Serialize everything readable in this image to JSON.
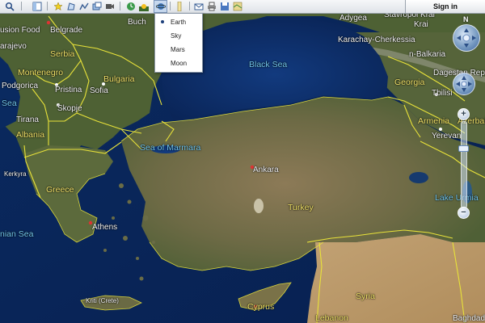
{
  "toolbar": {
    "tools": [
      {
        "icon": "search-icon"
      },
      {
        "icon": "sidebar-toggle-icon"
      },
      {
        "icon": "placemark-pin-icon"
      },
      {
        "icon": "polygon-icon"
      },
      {
        "icon": "path-icon"
      },
      {
        "icon": "overlay-icon"
      },
      {
        "icon": "record-tour-icon"
      },
      {
        "icon": "historical-imagery-icon"
      },
      {
        "icon": "sunlight-icon"
      },
      {
        "icon": "planets-icon"
      },
      {
        "icon": "ruler-icon"
      },
      {
        "icon": "email-icon"
      },
      {
        "icon": "print-icon"
      },
      {
        "icon": "save-image-icon"
      },
      {
        "icon": "view-in-maps-icon"
      }
    ],
    "sign_in_label": "Sign in"
  },
  "planet_menu": {
    "options": [
      "Earth",
      "Sky",
      "Mars",
      "Moon"
    ],
    "selected": "Earth"
  },
  "map": {
    "labels": [
      {
        "id": "belgrade",
        "text": "Belgrade",
        "kind": "land"
      },
      {
        "id": "fusion-food",
        "text": "usion Food",
        "kind": "land"
      },
      {
        "id": "sarajevo",
        "text": "arajevo",
        "kind": "land"
      },
      {
        "id": "serbia",
        "text": "Serbia",
        "kind": "country"
      },
      {
        "id": "montenegro",
        "text": "Montenegro",
        "kind": "country"
      },
      {
        "id": "bulgaria",
        "text": "Bulgaria",
        "kind": "country"
      },
      {
        "id": "podgorica",
        "text": "Podgorica",
        "kind": "land"
      },
      {
        "id": "pristina",
        "text": "Pristina",
        "kind": "land"
      },
      {
        "id": "sofia",
        "text": "Sofia",
        "kind": "land"
      },
      {
        "id": "skopje",
        "text": "Skopje",
        "kind": "land"
      },
      {
        "id": "tirana",
        "text": "Tirana",
        "kind": "land"
      },
      {
        "id": "albania",
        "text": "Albania",
        "kind": "country"
      },
      {
        "id": "buch",
        "text": "Buch",
        "kind": "land"
      },
      {
        "id": "black-sea",
        "text": "Black Sea",
        "kind": "sea"
      },
      {
        "id": "adygea",
        "text": "Adygea",
        "kind": "land"
      },
      {
        "id": "stavropol",
        "text": "Stavropol Krai",
        "kind": "land"
      },
      {
        "id": "krasnodar",
        "text": "Krai",
        "kind": "land"
      },
      {
        "id": "karachay",
        "text": "Karachay-Cherkessia",
        "kind": "land"
      },
      {
        "id": "kabardino",
        "text": "n-Balkaria",
        "kind": "land"
      },
      {
        "id": "georgia",
        "text": "Georgia",
        "kind": "country"
      },
      {
        "id": "dagestan",
        "text": "Dagestan Repub",
        "kind": "land"
      },
      {
        "id": "tbilisi",
        "text": "Tbilisi",
        "kind": "land"
      },
      {
        "id": "armenia",
        "text": "Armenia",
        "kind": "country"
      },
      {
        "id": "azerbaijan",
        "text": "Azerbai",
        "kind": "country"
      },
      {
        "id": "yerevan",
        "text": "Yerevan",
        "kind": "land"
      },
      {
        "id": "sea-of-marmara",
        "text": "Sea of Marmara",
        "kind": "sea"
      },
      {
        "id": "kerkyra",
        "text": "Kerkyra",
        "kind": "land"
      },
      {
        "id": "ankara",
        "text": "Ankara",
        "kind": "land"
      },
      {
        "id": "greece",
        "text": "Greece",
        "kind": "country"
      },
      {
        "id": "turkey",
        "text": "Turkey",
        "kind": "country"
      },
      {
        "id": "lake-urmia",
        "text": "Lake Urmia",
        "kind": "sea"
      },
      {
        "id": "ionian-sea",
        "text": "nian Sea",
        "kind": "sea"
      },
      {
        "id": "athens",
        "text": "Athens",
        "kind": "land"
      },
      {
        "id": "crete",
        "text": "Kriti (Crete)",
        "kind": "land"
      },
      {
        "id": "cyprus",
        "text": "Cyprus",
        "kind": "country"
      },
      {
        "id": "syria",
        "text": "Syria",
        "kind": "country"
      },
      {
        "id": "lebanon",
        "text": "Lebanon",
        "kind": "country"
      },
      {
        "id": "baghdad",
        "text": "Baghdad",
        "kind": "land"
      },
      {
        "id": "sea-left",
        "text": "Sea",
        "kind": "sea"
      }
    ]
  },
  "navigation": {
    "north_label": "N",
    "zoom_in_label": "+",
    "zoom_out_label": "−"
  },
  "colors": {
    "sea_deep": "#0b2a5e",
    "land_green": "#5a6b3c",
    "land_desert": "#b89766",
    "border_yellow": "#e8e23a",
    "label_sea": "#72c7ee",
    "label_country": "#f2e36a"
  }
}
